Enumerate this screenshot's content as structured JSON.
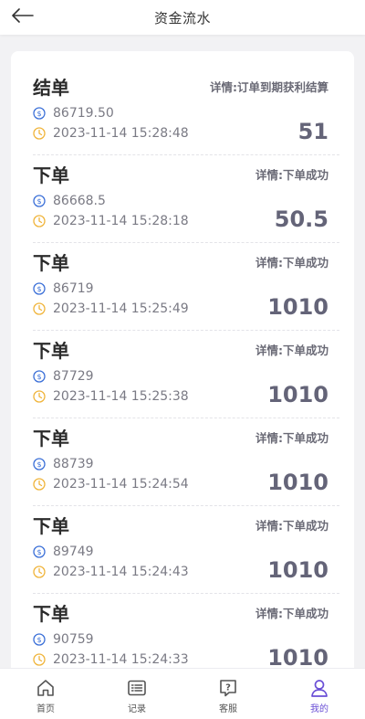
{
  "header": {
    "title": "资金流水"
  },
  "records": [
    {
      "type": "结单",
      "detail": "详情:订单到期获利结算",
      "price": "86719.50",
      "time": "2023-11-14 15:28:48",
      "amount": "51"
    },
    {
      "type": "下单",
      "detail": "详情:下单成功",
      "price": "86668.5",
      "time": "2023-11-14 15:28:18",
      "amount": "50.5"
    },
    {
      "type": "下单",
      "detail": "详情:下单成功",
      "price": "86719",
      "time": "2023-11-14 15:25:49",
      "amount": "1010"
    },
    {
      "type": "下单",
      "detail": "详情:下单成功",
      "price": "87729",
      "time": "2023-11-14 15:25:38",
      "amount": "1010"
    },
    {
      "type": "下单",
      "detail": "详情:下单成功",
      "price": "88739",
      "time": "2023-11-14 15:24:54",
      "amount": "1010"
    },
    {
      "type": "下单",
      "detail": "详情:下单成功",
      "price": "89749",
      "time": "2023-11-14 15:24:43",
      "amount": "1010"
    },
    {
      "type": "下单",
      "detail": "详情:下单成功",
      "price": "90759",
      "time": "2023-11-14 15:24:33",
      "amount": "1010"
    }
  ],
  "tabbar": {
    "items": [
      {
        "label": "首页",
        "icon": "home-icon"
      },
      {
        "label": "记录",
        "icon": "list-icon"
      },
      {
        "label": "客服",
        "icon": "help-chat-icon"
      },
      {
        "label": "我的",
        "icon": "user-icon",
        "active": true
      }
    ]
  },
  "colors": {
    "accent": "#6a4fd6",
    "coin_icon": "#3a6fd8",
    "clock_icon": "#f0b43a",
    "amount": "#646478"
  }
}
